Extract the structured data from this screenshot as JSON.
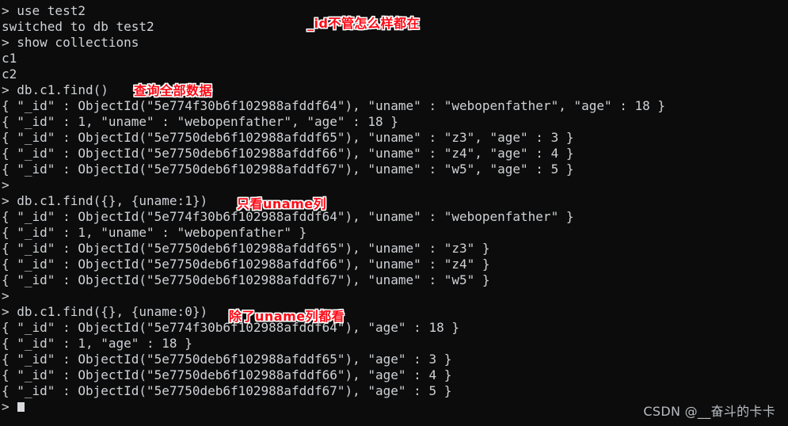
{
  "terminal": {
    "title": "mongo shell",
    "background_color": "#0c0c0c",
    "text_color": "#cfd2d6",
    "annotation_color": "#ff0a16",
    "annotation_outline_color": "#ffffff",
    "cursor": "block",
    "lines": [
      "> use test2",
      "switched to db test2",
      "> show collections",
      "c1",
      "c2",
      "> db.c1.find()",
      "{ \"_id\" : ObjectId(\"5e774f30b6f102988afddf64\"), \"uname\" : \"webopenfather\", \"age\" : 18 }",
      "{ \"_id\" : 1, \"uname\" : \"webopenfather\", \"age\" : 18 }",
      "{ \"_id\" : ObjectId(\"5e7750deb6f102988afddf65\"), \"uname\" : \"z3\", \"age\" : 3 }",
      "{ \"_id\" : ObjectId(\"5e7750deb6f102988afddf66\"), \"uname\" : \"z4\", \"age\" : 4 }",
      "{ \"_id\" : ObjectId(\"5e7750deb6f102988afddf67\"), \"uname\" : \"w5\", \"age\" : 5 }",
      ">",
      "> db.c1.find({}, {uname:1})",
      "{ \"_id\" : ObjectId(\"5e774f30b6f102988afddf64\"), \"uname\" : \"webopenfather\" }",
      "{ \"_id\" : 1, \"uname\" : \"webopenfather\" }",
      "{ \"_id\" : ObjectId(\"5e7750deb6f102988afddf65\"), \"uname\" : \"z3\" }",
      "{ \"_id\" : ObjectId(\"5e7750deb6f102988afddf66\"), \"uname\" : \"z4\" }",
      "{ \"_id\" : ObjectId(\"5e7750deb6f102988afddf67\"), \"uname\" : \"w5\" }",
      ">",
      "> db.c1.find({}, {uname:0})",
      "{ \"_id\" : ObjectId(\"5e774f30b6f102988afddf64\"), \"age\" : 18 }",
      "{ \"_id\" : 1, \"age\" : 18 }",
      "{ \"_id\" : ObjectId(\"5e7750deb6f102988afddf65\"), \"age\" : 3 }",
      "{ \"_id\" : ObjectId(\"5e7750deb6f102988afddf66\"), \"age\" : 4 }",
      "{ \"_id\" : ObjectId(\"5e7750deb6f102988afddf67\"), \"age\" : 5 }"
    ],
    "final_prompt": ">"
  },
  "annotations": [
    {
      "text": "_id不管怎么样都在"
    },
    {
      "text": "查询全部数据"
    },
    {
      "text": "只看uname列"
    },
    {
      "text": "除了uname列都看"
    }
  ],
  "watermark": {
    "text": "CSDN @__奋斗的卡卡"
  }
}
